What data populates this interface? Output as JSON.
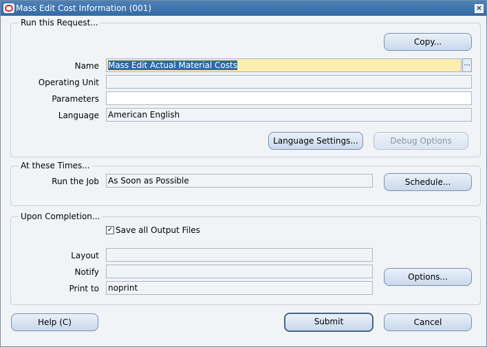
{
  "window": {
    "title": "Mass Edit Cost Information (001)",
    "close_glyph": "×"
  },
  "run_request": {
    "group_title": "Run this Request...",
    "copy_label": "Copy...",
    "name_label": "Name",
    "name_value": "Mass Edit Actual Material Costs",
    "lov_glyph": "...",
    "operating_unit_label": "Operating Unit",
    "operating_unit_value": "",
    "parameters_label": "Parameters",
    "parameters_value": "",
    "language_label": "Language",
    "language_value": "American English",
    "language_settings_label": "Language Settings...",
    "debug_options_label": "Debug Options"
  },
  "at_times": {
    "group_title": "At these Times...",
    "run_job_label": "Run the Job",
    "run_job_value": "As Soon as Possible",
    "schedule_label": "Schedule..."
  },
  "upon_completion": {
    "group_title": "Upon Completion...",
    "save_output_label": "Save all Output Files",
    "save_output_checked": true,
    "check_glyph": "✓",
    "layout_label": "Layout",
    "layout_value": "",
    "notify_label": "Notify",
    "notify_value": "",
    "print_to_label": "Print to",
    "print_to_value": "noprint",
    "options_label": "Options..."
  },
  "footer": {
    "help_label": "Help (C)",
    "submit_label": "Submit",
    "cancel_label": "Cancel"
  },
  "colors": {
    "title_bar": "#336aa4",
    "required_field": "#fbeeb0",
    "selection": "#3168a6"
  }
}
